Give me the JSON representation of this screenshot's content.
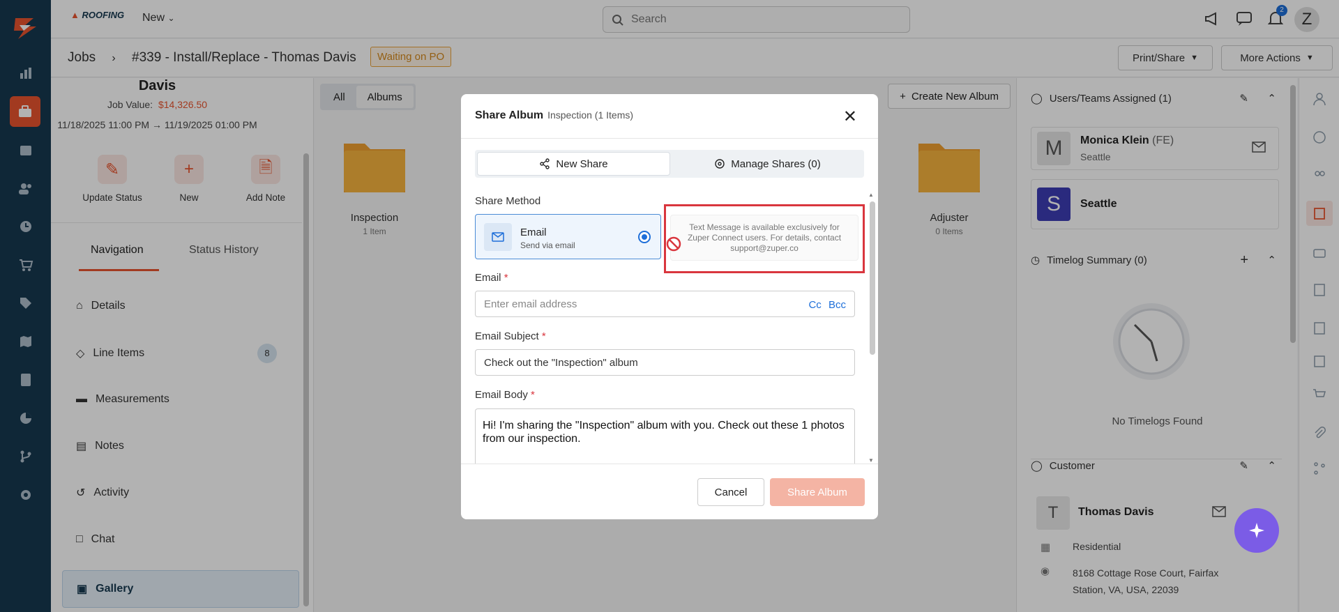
{
  "header": {
    "brand": "ROOFING",
    "new_label": "New",
    "search_placeholder": "Search",
    "notif_count": "2",
    "avatar": "Z"
  },
  "subheader": {
    "crumb_root": "Jobs",
    "crumb_title": "#339 - Install/Replace - Thomas Davis",
    "status": "Waiting on PO",
    "print_share": "Print/Share",
    "more_actions": "More Actions"
  },
  "job": {
    "name": "Davis",
    "value_label": "Job Value:",
    "value": "$14,326.50",
    "dates": "11/18/2025 11:00 PM → 11/19/2025 01:00 PM"
  },
  "actions": [
    "Update Status",
    "New",
    "Add Note"
  ],
  "tabs": [
    "Navigation",
    "Status History"
  ],
  "nav": [
    {
      "label": "Details"
    },
    {
      "label": "Line Items",
      "count": "8"
    },
    {
      "label": "Measurements"
    },
    {
      "label": "Notes"
    },
    {
      "label": "Activity"
    },
    {
      "label": "Chat"
    },
    {
      "label": "Gallery"
    }
  ],
  "gallery": {
    "seg_all": "All",
    "seg_albums": "Albums",
    "create_album": "Create New Album",
    "folders": [
      {
        "label": "Inspection",
        "count": "1 Item"
      },
      {
        "label": "Adjuster",
        "count": "0 Items"
      }
    ]
  },
  "right": {
    "users_title": "Users/Teams Assigned (1)",
    "user_initial": "M",
    "user_name": "Monica Klein",
    "user_role": "(FE)",
    "user_team": "Seattle",
    "team_initial": "S",
    "team_name": "Seattle",
    "timelog_title": "Timelog Summary (0)",
    "no_timelogs": "No Timelogs Found",
    "customer_title": "Customer",
    "cust_initial": "T",
    "cust_name": "Thomas Davis",
    "cust_type": "Residential",
    "cust_addr1": "8168 Cottage Rose Court, Fairfax",
    "cust_addr2": "Station, VA, USA, 22039"
  },
  "modal": {
    "title": "Share Album",
    "subtitle": "Inspection (1 Items)",
    "tab_new": "New Share",
    "tab_manage": "Manage Shares (0)",
    "share_method_label": "Share Method",
    "email_title": "Email",
    "email_sub": "Send via email",
    "sms_note": "Text Message is available exclusively for Zuper Connect users. For details, contact support@zuper.co",
    "email_label": "Email",
    "email_placeholder": "Enter email address",
    "cc": "Cc",
    "bcc": "Bcc",
    "subject_label": "Email Subject",
    "subject_value": "Check out the \"Inspection\" album",
    "body_label": "Email Body",
    "body_value": "Hi! I'm sharing the \"Inspection\" album with you. Check out these 1 photos from our inspection.",
    "cancel": "Cancel",
    "share": "Share Album"
  },
  "colors": {
    "accent": "#e8542e",
    "primary": "#1e6fd9",
    "rail": "#16384f",
    "alert": "#d9363e"
  }
}
